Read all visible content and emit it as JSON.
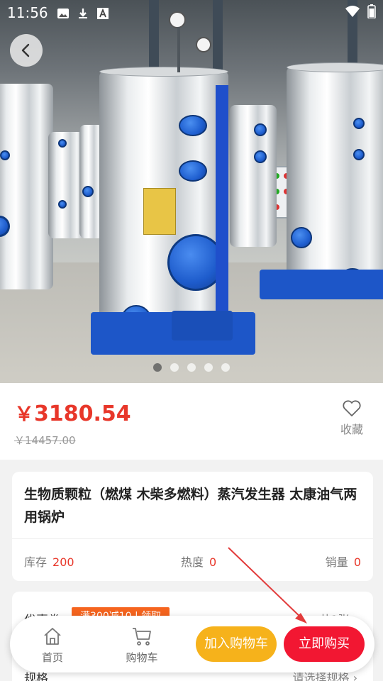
{
  "status_bar": {
    "time": "11:56"
  },
  "gallery": {
    "slide_count": 5,
    "active_index": 0
  },
  "price": {
    "symbol": "￥",
    "current": "3180.54",
    "original": "￥14457.00"
  },
  "favorite": {
    "label": "收藏",
    "icon": "heart-outline-icon"
  },
  "product": {
    "title": "生物质颗粒（燃煤 木柴多燃料）蒸汽发生器 太康油气两用锅炉",
    "stats": [
      {
        "label": "库存",
        "value": "200"
      },
      {
        "label": "热度",
        "value": "0"
      },
      {
        "label": "销量",
        "value": "0"
      }
    ]
  },
  "coupon": {
    "label": "优惠券",
    "tag": "满300减10 | 领取",
    "count": "共1张"
  },
  "spec": {
    "label": "规格",
    "hint": "请选择规格"
  },
  "bottom_bar": {
    "home_label": "首页",
    "cart_label": "购物车",
    "add_to_cart": "加入购物车",
    "buy_now": "立即购买"
  },
  "colors": {
    "price_red": "#e8372a",
    "cart_yellow": "#f6b21b",
    "buy_red": "#f21732",
    "coupon_orange": "#f5641e"
  }
}
